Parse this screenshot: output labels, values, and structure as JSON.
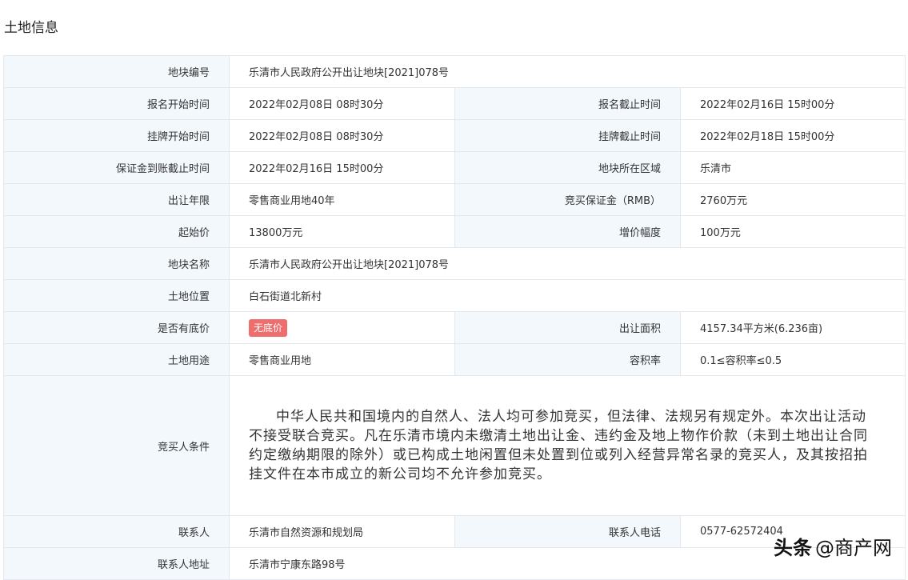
{
  "page_title": "土地信息",
  "rows": {
    "plot_no": {
      "label": "地块编号",
      "value": "乐清市人民政府公开出让地块[2021]078号"
    },
    "reg_start": {
      "label": "报名开始时间",
      "value": "2022年02月08日 08时30分"
    },
    "reg_end": {
      "label": "报名截止时间",
      "value": "2022年02月16日 15时00分"
    },
    "list_start": {
      "label": "挂牌开始时间",
      "value": "2022年02月08日 08时30分"
    },
    "list_end": {
      "label": "挂牌截止时间",
      "value": "2022年02月18日 15时00分"
    },
    "deposit_deadline": {
      "label": "保证金到账截止时间",
      "value": "2022年02月16日 15时00分"
    },
    "district": {
      "label": "地块所在区域",
      "value": "乐清市"
    },
    "term": {
      "label": "出让年限",
      "value": "零售商业用地40年"
    },
    "deposit": {
      "label": "竞买保证金（RMB）",
      "value": "2760万元"
    },
    "start_price": {
      "label": "起始价",
      "value": "13800万元"
    },
    "increment": {
      "label": "增价幅度",
      "value": "100万元"
    },
    "plot_name": {
      "label": "地块名称",
      "value": "乐清市人民政府公开出让地块[2021]078号"
    },
    "location": {
      "label": "土地位置",
      "value": "白石街道北新村"
    },
    "reserve_price": {
      "label": "是否有底价",
      "badge": "无底价"
    },
    "area": {
      "label": "出让面积",
      "value": "4157.34平方米(6.236亩)"
    },
    "usage": {
      "label": "土地用途",
      "value": "零售商业用地"
    },
    "far": {
      "label": "容积率",
      "value": "0.1≤容积率≤0.5"
    },
    "conditions": {
      "label": "竞买人条件",
      "value": "中华人民共和国境内的自然人、法人均可参加竞买，但法律、法规另有规定外。本次出让活动不接受联合竞买。凡在乐清市境内未缴清土地出让金、违约金及地上物作价款（未到土地出让合同约定缴纳期限的除外）或已构成土地闲置但未处置到位或列入经营异常名录的竞买人，及其按招拍挂文件在本市成立的新公司均不允许参加竞买。"
    },
    "contact": {
      "label": "联系人",
      "value": "乐清市自然资源和规划局"
    },
    "phone": {
      "label": "联系人电话",
      "value": "0577-62572404"
    },
    "address": {
      "label": "联系人地址",
      "value": "乐清市宁康东路98号"
    }
  },
  "watermark": {
    "part1": "头条",
    "part2": "@商产网"
  },
  "colors": {
    "label_bg": "#f3f8fd",
    "border": "#e4e8ee",
    "badge_bg": "#ee6e6e"
  }
}
